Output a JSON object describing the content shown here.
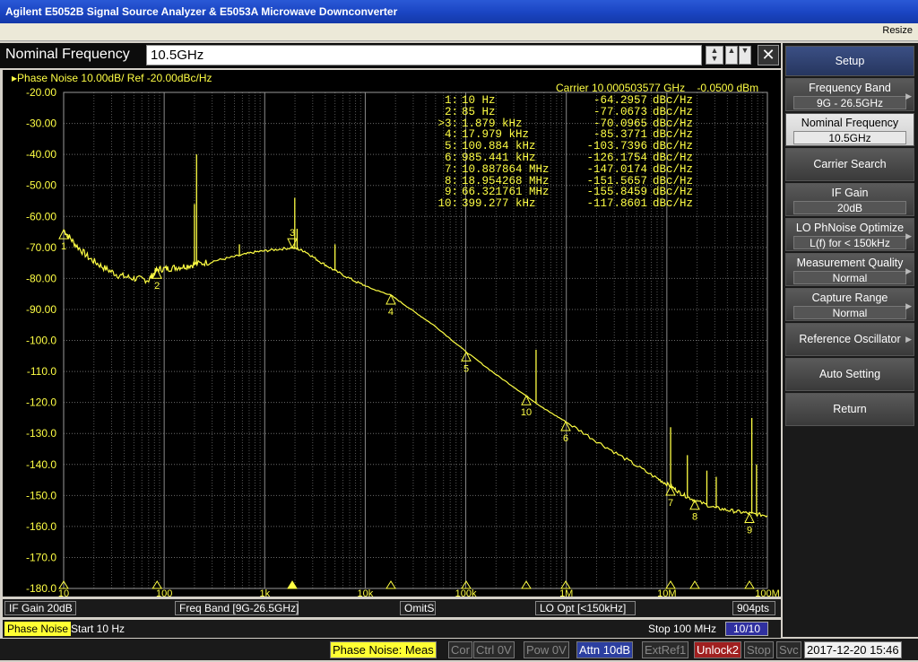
{
  "window": {
    "title": "Agilent E5052B Signal Source Analyzer & E5053A Microwave Downconverter",
    "resize_label": "Resize"
  },
  "entry": {
    "label": "Nominal Frequency",
    "value": "10.5GHz",
    "close_symbol": "✕"
  },
  "plot": {
    "trace_title": "Phase Noise 10.00dB/ Ref -20.00dBc/Hz",
    "carrier_label": "Carrier 10.000503577 GHz",
    "carrier_power": "-0.0500 dBm"
  },
  "markers": [
    {
      "idx": "1:",
      "freq": "10 Hz",
      "value": "-64.2957",
      "unit": "dBc/Hz"
    },
    {
      "idx": "2:",
      "freq": "85 Hz",
      "value": "-77.0673",
      "unit": "dBc/Hz"
    },
    {
      "idx": ">3:",
      "freq": "1.879 kHz",
      "value": "-70.0965",
      "unit": "dBc/Hz"
    },
    {
      "idx": "4:",
      "freq": "17.979 kHz",
      "value": "-85.3771",
      "unit": "dBc/Hz"
    },
    {
      "idx": "5:",
      "freq": "100.884 kHz",
      "value": "-103.7396",
      "unit": "dBc/Hz"
    },
    {
      "idx": "6:",
      "freq": "985.441 kHz",
      "value": "-126.1754",
      "unit": "dBc/Hz"
    },
    {
      "idx": "7:",
      "freq": "10.887864 MHz",
      "value": "-147.0174",
      "unit": "dBc/Hz"
    },
    {
      "idx": "8:",
      "freq": "18.954268 MHz",
      "value": "-151.5657",
      "unit": "dBc/Hz"
    },
    {
      "idx": "9:",
      "freq": "66.321761 MHz",
      "value": "-155.8459",
      "unit": "dBc/Hz"
    },
    {
      "idx": "10:",
      "freq": "399.277 kHz",
      "value": "-117.8601",
      "unit": "dBc/Hz"
    }
  ],
  "chart_data": {
    "type": "line",
    "title": "Phase Noise 10.00dB/ Ref -20.00dBc/Hz",
    "x_scale": "log",
    "xlim": [
      10,
      100000000
    ],
    "ylim": [
      -180,
      -20
    ],
    "x_ticks": [
      "10",
      "100",
      "1k",
      "10k",
      "100k",
      "1M",
      "10M",
      "100M"
    ],
    "y_ticks": [
      "-20.00",
      "-30.00",
      "-40.00",
      "-50.00",
      "-60.00",
      "-70.00",
      "-80.00",
      "-90.00",
      "-100.0",
      "-110.0",
      "-120.0",
      "-130.0",
      "-140.0",
      "-150.0",
      "-160.0",
      "-170.0",
      "-180.0"
    ],
    "grid": true,
    "series": [
      {
        "color": "#ffff44",
        "x": [
          10,
          13,
          18,
          25,
          35,
          50,
          70,
          85,
          110,
          150,
          200,
          300,
          500,
          800,
          1200,
          1879,
          2500,
          3500,
          5000,
          8000,
          12000,
          17979,
          30000,
          50000,
          100884,
          200000,
          399277,
          600000,
          985441,
          2000000,
          4000000,
          8000000,
          10887864,
          14000000,
          18954268,
          30000000,
          45000000,
          66321761,
          100000000
        ],
        "y": [
          -64.3,
          -69,
          -73.5,
          -76.5,
          -79,
          -80,
          -80.5,
          -77.1,
          -76.8,
          -76.2,
          -75.5,
          -74.5,
          -73,
          -71.5,
          -70.8,
          -70.1,
          -71.2,
          -74.5,
          -77.5,
          -81,
          -83.5,
          -85.4,
          -90.5,
          -95.5,
          -103.7,
          -111,
          -117.9,
          -122,
          -126.2,
          -132.5,
          -138.5,
          -144.5,
          -147.0,
          -149.5,
          -151.6,
          -154,
          -155,
          -155.8,
          -156.5
        ]
      }
    ],
    "spurs": [
      {
        "x": 200,
        "y": -56
      },
      {
        "x": 210,
        "y": -40
      },
      {
        "x": 560,
        "y": -69
      },
      {
        "x": 1990,
        "y": -54
      },
      {
        "x": 2100,
        "y": -64
      },
      {
        "x": 5000,
        "y": -69
      },
      {
        "x": 500000,
        "y": -103
      },
      {
        "x": 10900000,
        "y": -128
      },
      {
        "x": 16000000,
        "y": -137
      },
      {
        "x": 25000000,
        "y": -142
      },
      {
        "x": 31000000,
        "y": -144
      },
      {
        "x": 70000000,
        "y": -125
      },
      {
        "x": 78000000,
        "y": -140
      }
    ],
    "markers": [
      {
        "label": "1",
        "x": 10,
        "y": -64.2957
      },
      {
        "label": "2",
        "x": 85,
        "y": -77.0673
      },
      {
        "label": "3",
        "x": 1879,
        "y": -70.0965
      },
      {
        "label": "4",
        "x": 17979,
        "y": -85.3771
      },
      {
        "label": "5",
        "x": 100884,
        "y": -103.7396
      },
      {
        "label": "6",
        "x": 985441,
        "y": -126.1754
      },
      {
        "label": "7",
        "x": 10887864,
        "y": -147.0174
      },
      {
        "label": "8",
        "x": 18954268,
        "y": -151.5657
      },
      {
        "label": "9",
        "x": 66321761,
        "y": -155.8459
      },
      {
        "label": "10",
        "x": 399277,
        "y": -117.8601
      }
    ]
  },
  "status1": {
    "if_gain": "IF Gain 20dB",
    "freq_band": "Freq Band [9G-26.5GHz]",
    "omits": "OmitS",
    "lo_opt": "LO Opt [<150kHz]",
    "points": "904pts"
  },
  "status2": {
    "trace_name": "Phase Noise",
    "start": "Start 10 Hz",
    "stop": "Stop 100 MHz",
    "channel": "10/10"
  },
  "indicators": {
    "meas": "Phase Noise: Meas",
    "cor": "Cor",
    "ctrl": "Ctrl  0V",
    "pow": "Pow  0V",
    "atten": "Attn 10dB",
    "extref": "ExtRef1",
    "unlock": "Unlock2",
    "stop": "Stop",
    "svc": "Svc",
    "datetime": "2017-12-20 15:46"
  },
  "softkeys": {
    "header": "Setup",
    "freq_band": {
      "label": "Frequency Band",
      "value": "9G - 26.5GHz"
    },
    "nominal_freq": {
      "label": "Nominal Frequency",
      "value": "10.5GHz"
    },
    "carrier_search": "Carrier Search",
    "if_gain": {
      "label": "IF Gain",
      "value": "20dB"
    },
    "lo_phnoise": {
      "label": "LO PhNoise Optimize",
      "value": "L(f) for < 150kHz"
    },
    "meas_quality": {
      "label": "Measurement Quality",
      "value": "Normal"
    },
    "capture_range": {
      "label": "Capture Range",
      "value": "Normal"
    },
    "ref_osc": "Reference Oscillator",
    "auto_setting": "Auto Setting",
    "return_label": "Return"
  }
}
